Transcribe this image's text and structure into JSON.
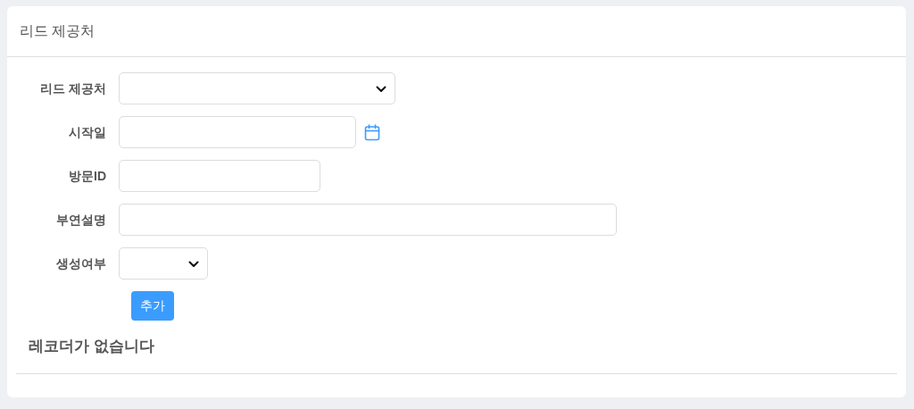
{
  "card": {
    "title": "리드 제공처"
  },
  "fields": [
    {
      "label": "리드 제공처",
      "kind": "select"
    },
    {
      "label": "시작일",
      "kind": "date"
    },
    {
      "label": "방문ID",
      "kind": "text"
    },
    {
      "label": "부연설명",
      "kind": "text"
    },
    {
      "label": "생성여부",
      "kind": "select"
    }
  ],
  "add_button": "추가",
  "empty_message": "레코더가 없습니다"
}
